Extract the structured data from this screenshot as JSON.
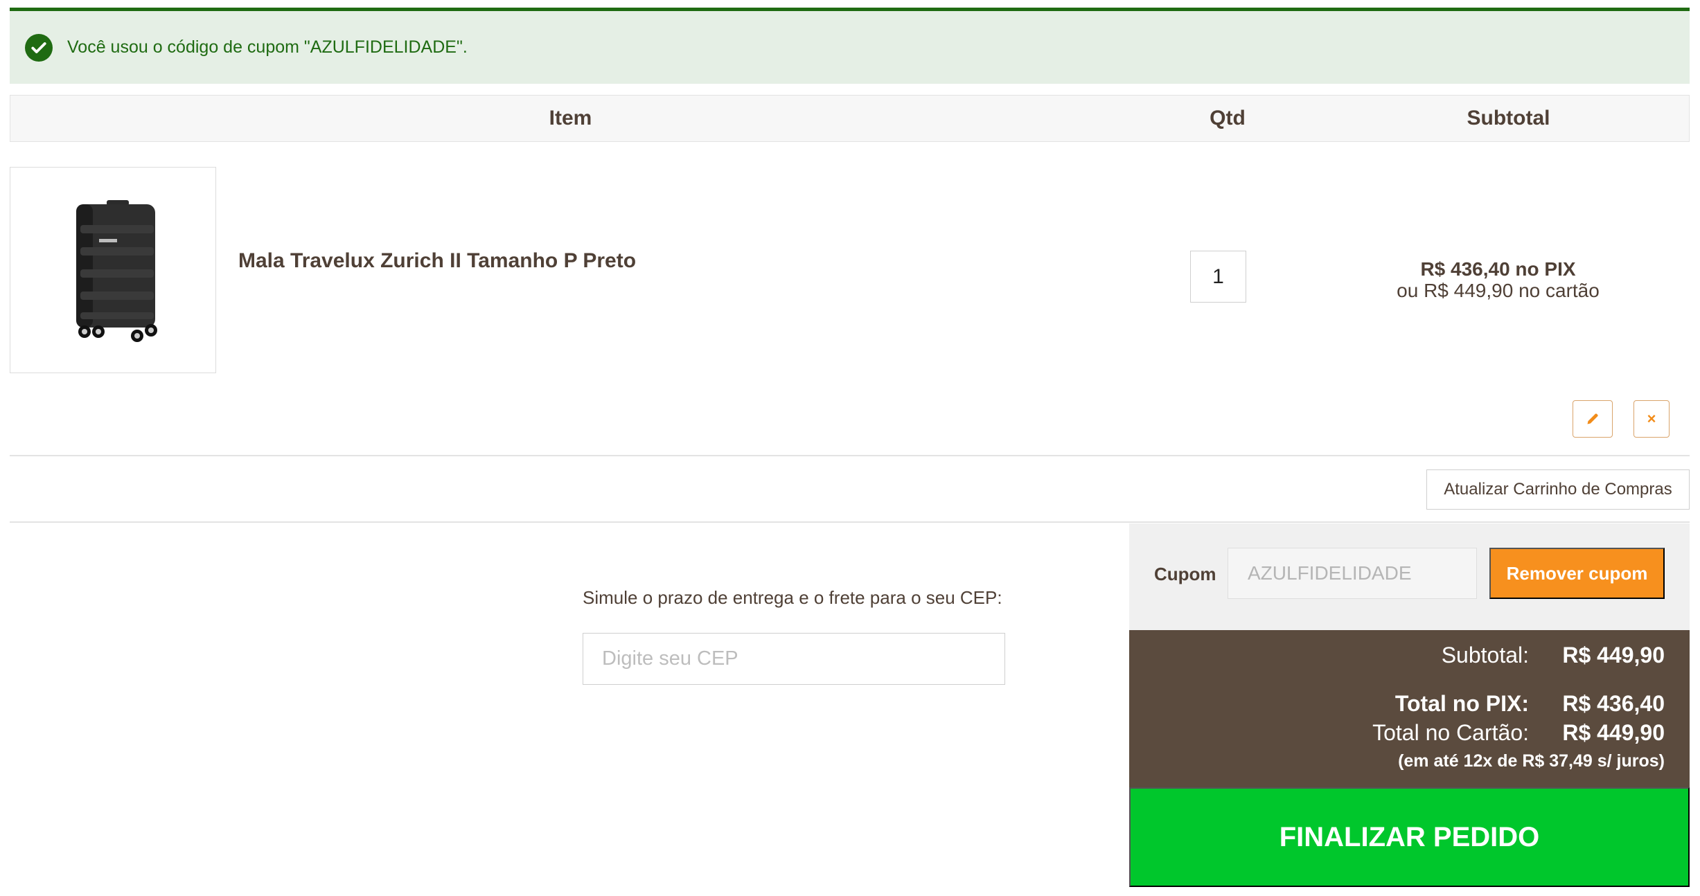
{
  "alert": {
    "message": "Você usou o código de cupom \"AZULFIDELIDADE\".",
    "icon": "check-circle-icon",
    "color": "#1f6b12"
  },
  "table": {
    "headers": {
      "item": "Item",
      "qty": "Qtd",
      "subtotal": "Subtotal"
    }
  },
  "cart_items": [
    {
      "name": "Mala Travelux Zurich II Tamanho P Preto",
      "qty": "1",
      "price_pix": "R$ 436,40 no PIX",
      "price_card": "ou R$ 449,90 no cartão",
      "image": "black-suitcase-image"
    }
  ],
  "actions": {
    "edit_icon": "pencil-icon",
    "remove_icon": "close-icon",
    "remove_symbol": "×",
    "update_cart": "Atualizar Carrinho de Compras"
  },
  "shipping": {
    "label": "Simule o prazo de entrega e o frete para o seu CEP:",
    "placeholder": "Digite seu CEP"
  },
  "coupon": {
    "label": "Cupom",
    "value": "AZULFIDELIDADE",
    "button": "Remover cupom",
    "button_color": "#f7901e"
  },
  "totals": {
    "subtotal_label": "Subtotal:",
    "subtotal_value": "R$ 449,90",
    "pix_label": "Total no PIX:",
    "pix_value": "R$ 436,40",
    "card_label": "Total no Cartão:",
    "card_value": "R$ 449,90",
    "installments": "(em até 12x de R$ 37,49 s/ juros)",
    "background": "#5b4b3e"
  },
  "checkout": {
    "label": "FINALIZAR PEDIDO",
    "color": "#00c72c"
  }
}
